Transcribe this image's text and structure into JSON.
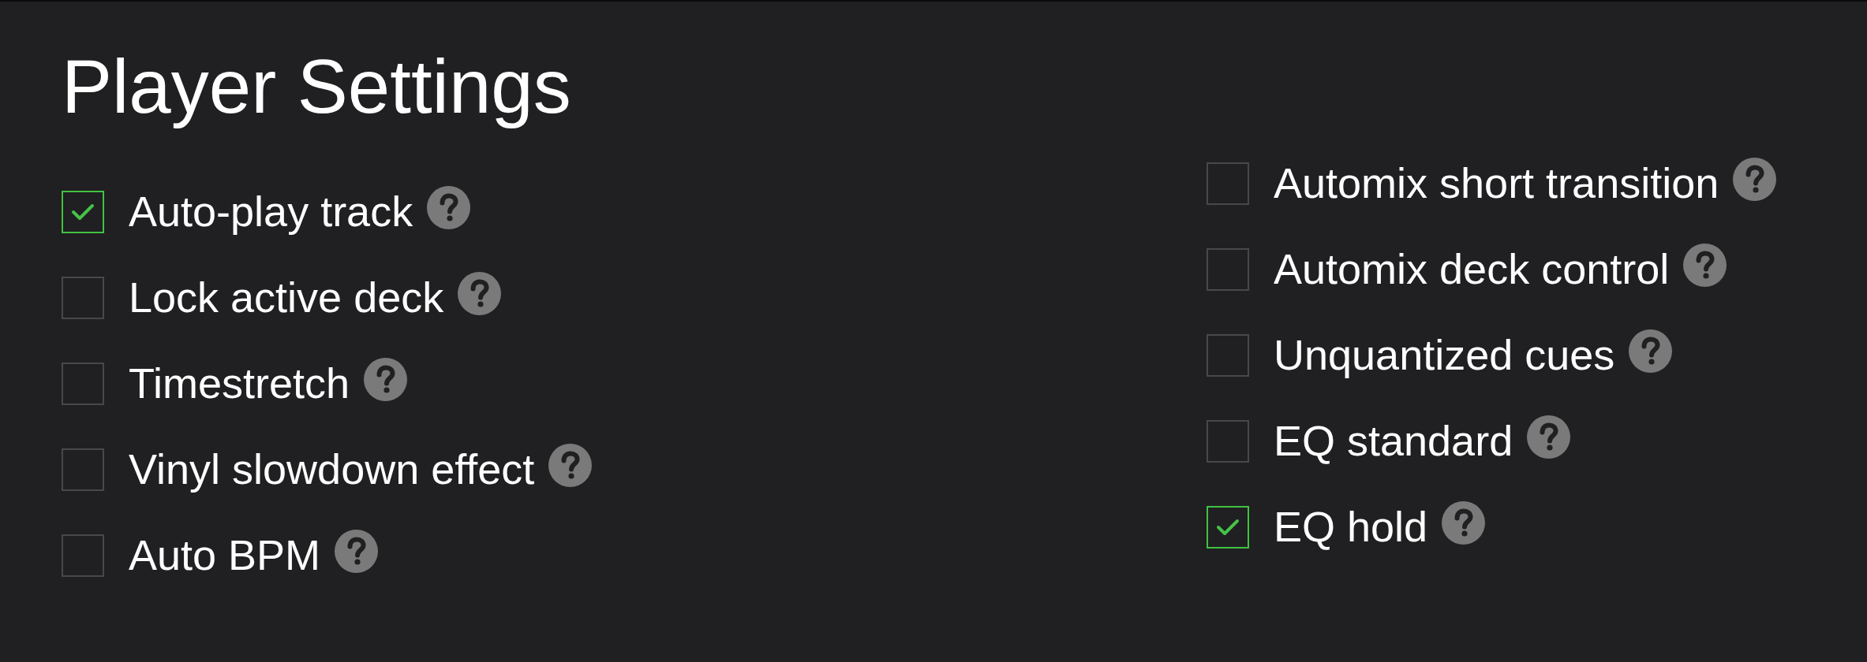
{
  "title": "Player Settings",
  "columns": [
    {
      "options": [
        {
          "label": "Auto-play track",
          "checked": true
        },
        {
          "label": "Lock active deck",
          "checked": false
        },
        {
          "label": "Timestretch",
          "checked": false
        },
        {
          "label": "Vinyl slowdown effect",
          "checked": false
        },
        {
          "label": "Auto BPM",
          "checked": false
        }
      ]
    },
    {
      "options": [
        {
          "label": "Automix short transition",
          "checked": false
        },
        {
          "label": "Automix deck control",
          "checked": false
        },
        {
          "label": "Unquantized cues",
          "checked": false
        },
        {
          "label": "EQ standard",
          "checked": false
        },
        {
          "label": "EQ hold",
          "checked": true
        }
      ]
    }
  ]
}
